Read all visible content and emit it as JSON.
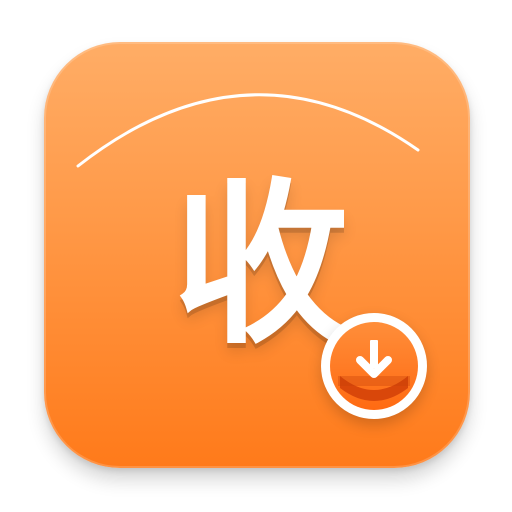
{
  "app_icon": {
    "glyph_text": "收",
    "colors": {
      "top": "#ffad66",
      "bottom": "#ff7a1a",
      "glyph": "#ffffff",
      "badge_ring": "#ffffff",
      "badge_fill": "#ff6a12",
      "badge_tray": "#d9470a"
    },
    "decorative_arc_icon": "arc-highlight-icon",
    "badge_icon": "download-arrow-icon"
  }
}
